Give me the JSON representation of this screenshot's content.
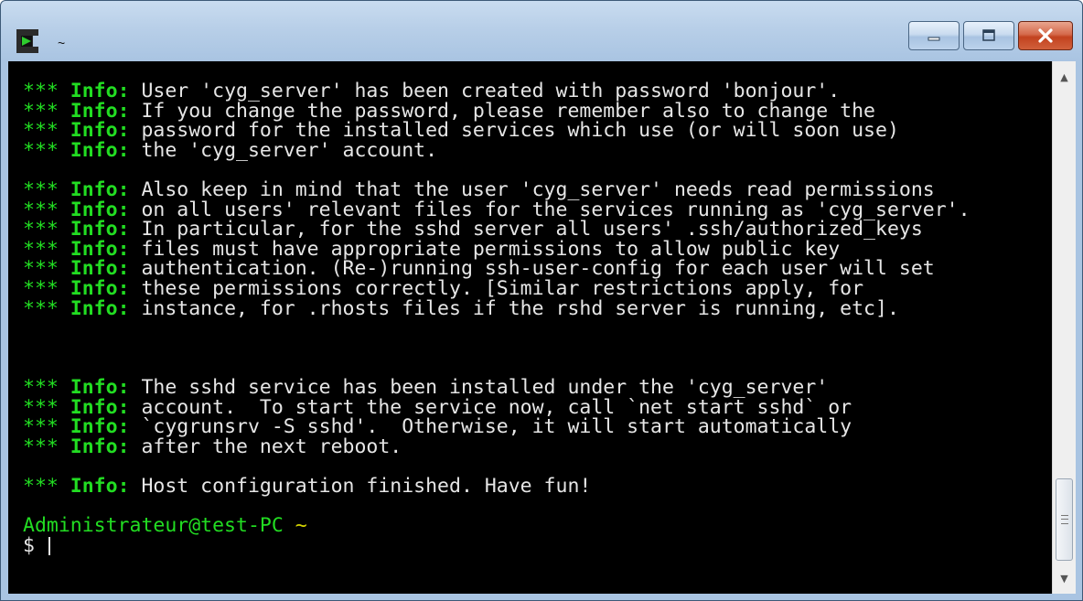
{
  "window": {
    "title": "~",
    "icon": "cygwin-terminal-icon",
    "controls": {
      "minimize_icon": "minimize-icon",
      "maximize_icon": "maximize-icon",
      "close_icon": "close-icon"
    }
  },
  "terminal": {
    "colors": {
      "background": "#000000",
      "text": "#e6e6e6",
      "info": "#22dd22",
      "path": "#d6d600"
    },
    "lines": [
      {
        "stars": "***",
        "info": " Info:",
        "text": " User 'cyg_server' has been created with password 'bonjour'."
      },
      {
        "stars": "***",
        "info": " Info:",
        "text": " If you change the password, please remember also to change the"
      },
      {
        "stars": "***",
        "info": " Info:",
        "text": " password for the installed services which use (or will soon use)"
      },
      {
        "stars": "***",
        "info": " Info:",
        "text": " the 'cyg_server' account."
      },
      {
        "stars": "",
        "info": "",
        "text": ""
      },
      {
        "stars": "***",
        "info": " Info:",
        "text": " Also keep in mind that the user 'cyg_server' needs read permissions"
      },
      {
        "stars": "***",
        "info": " Info:",
        "text": " on all users' relevant files for the services running as 'cyg_server'."
      },
      {
        "stars": "***",
        "info": " Info:",
        "text": " In particular, for the sshd server all users' .ssh/authorized_keys"
      },
      {
        "stars": "***",
        "info": " Info:",
        "text": " files must have appropriate permissions to allow public key"
      },
      {
        "stars": "***",
        "info": " Info:",
        "text": " authentication. (Re-)running ssh-user-config for each user will set"
      },
      {
        "stars": "***",
        "info": " Info:",
        "text": " these permissions correctly. [Similar restrictions apply, for"
      },
      {
        "stars": "***",
        "info": " Info:",
        "text": " instance, for .rhosts files if the rshd server is running, etc]."
      },
      {
        "stars": "",
        "info": "",
        "text": ""
      },
      {
        "stars": "",
        "info": "",
        "text": ""
      },
      {
        "stars": "",
        "info": "",
        "text": ""
      },
      {
        "stars": "***",
        "info": " Info:",
        "text": " The sshd service has been installed under the 'cyg_server'"
      },
      {
        "stars": "***",
        "info": " Info:",
        "text": " account.  To start the service now, call `net start sshd` or"
      },
      {
        "stars": "***",
        "info": " Info:",
        "text": " `cygrunsrv -S sshd'.  Otherwise, it will start automatically"
      },
      {
        "stars": "***",
        "info": " Info:",
        "text": " after the next reboot."
      },
      {
        "stars": "",
        "info": "",
        "text": ""
      },
      {
        "stars": "***",
        "info": " Info:",
        "text": " Host configuration finished. Have fun!"
      },
      {
        "stars": "",
        "info": "",
        "text": ""
      }
    ],
    "prompt": {
      "user_host": "Administrateur@test-PC",
      "path": " ~",
      "symbol": "$ "
    }
  },
  "scrollbar": {
    "up_icon": "scroll-up-arrow-icon",
    "down_icon": "scroll-down-arrow-icon",
    "position": 0.93
  }
}
